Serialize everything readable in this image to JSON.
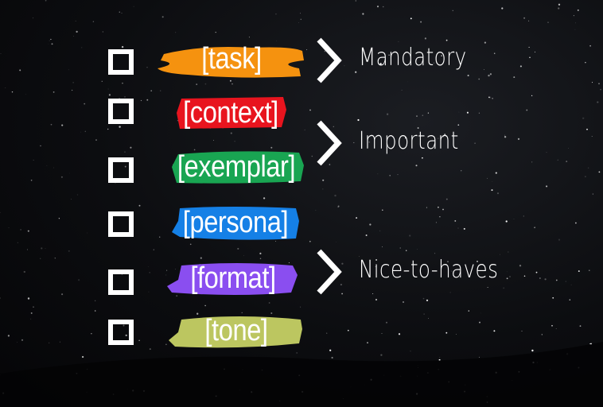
{
  "items": [
    {
      "label": "[task]",
      "color": "#f5920f"
    },
    {
      "label": "[context]",
      "color": "#e8141e"
    },
    {
      "label": "[exemplar]",
      "color": "#19a552"
    },
    {
      "label": "[persona]",
      "color": "#1580e6"
    },
    {
      "label": "[format]",
      "color": "#8a4ef0"
    },
    {
      "label": "[tone]",
      "color": "#bcc660"
    }
  ],
  "categories": [
    {
      "label": "Mandatory"
    },
    {
      "label": "Important"
    },
    {
      "label": "Nice-to-haves"
    }
  ]
}
